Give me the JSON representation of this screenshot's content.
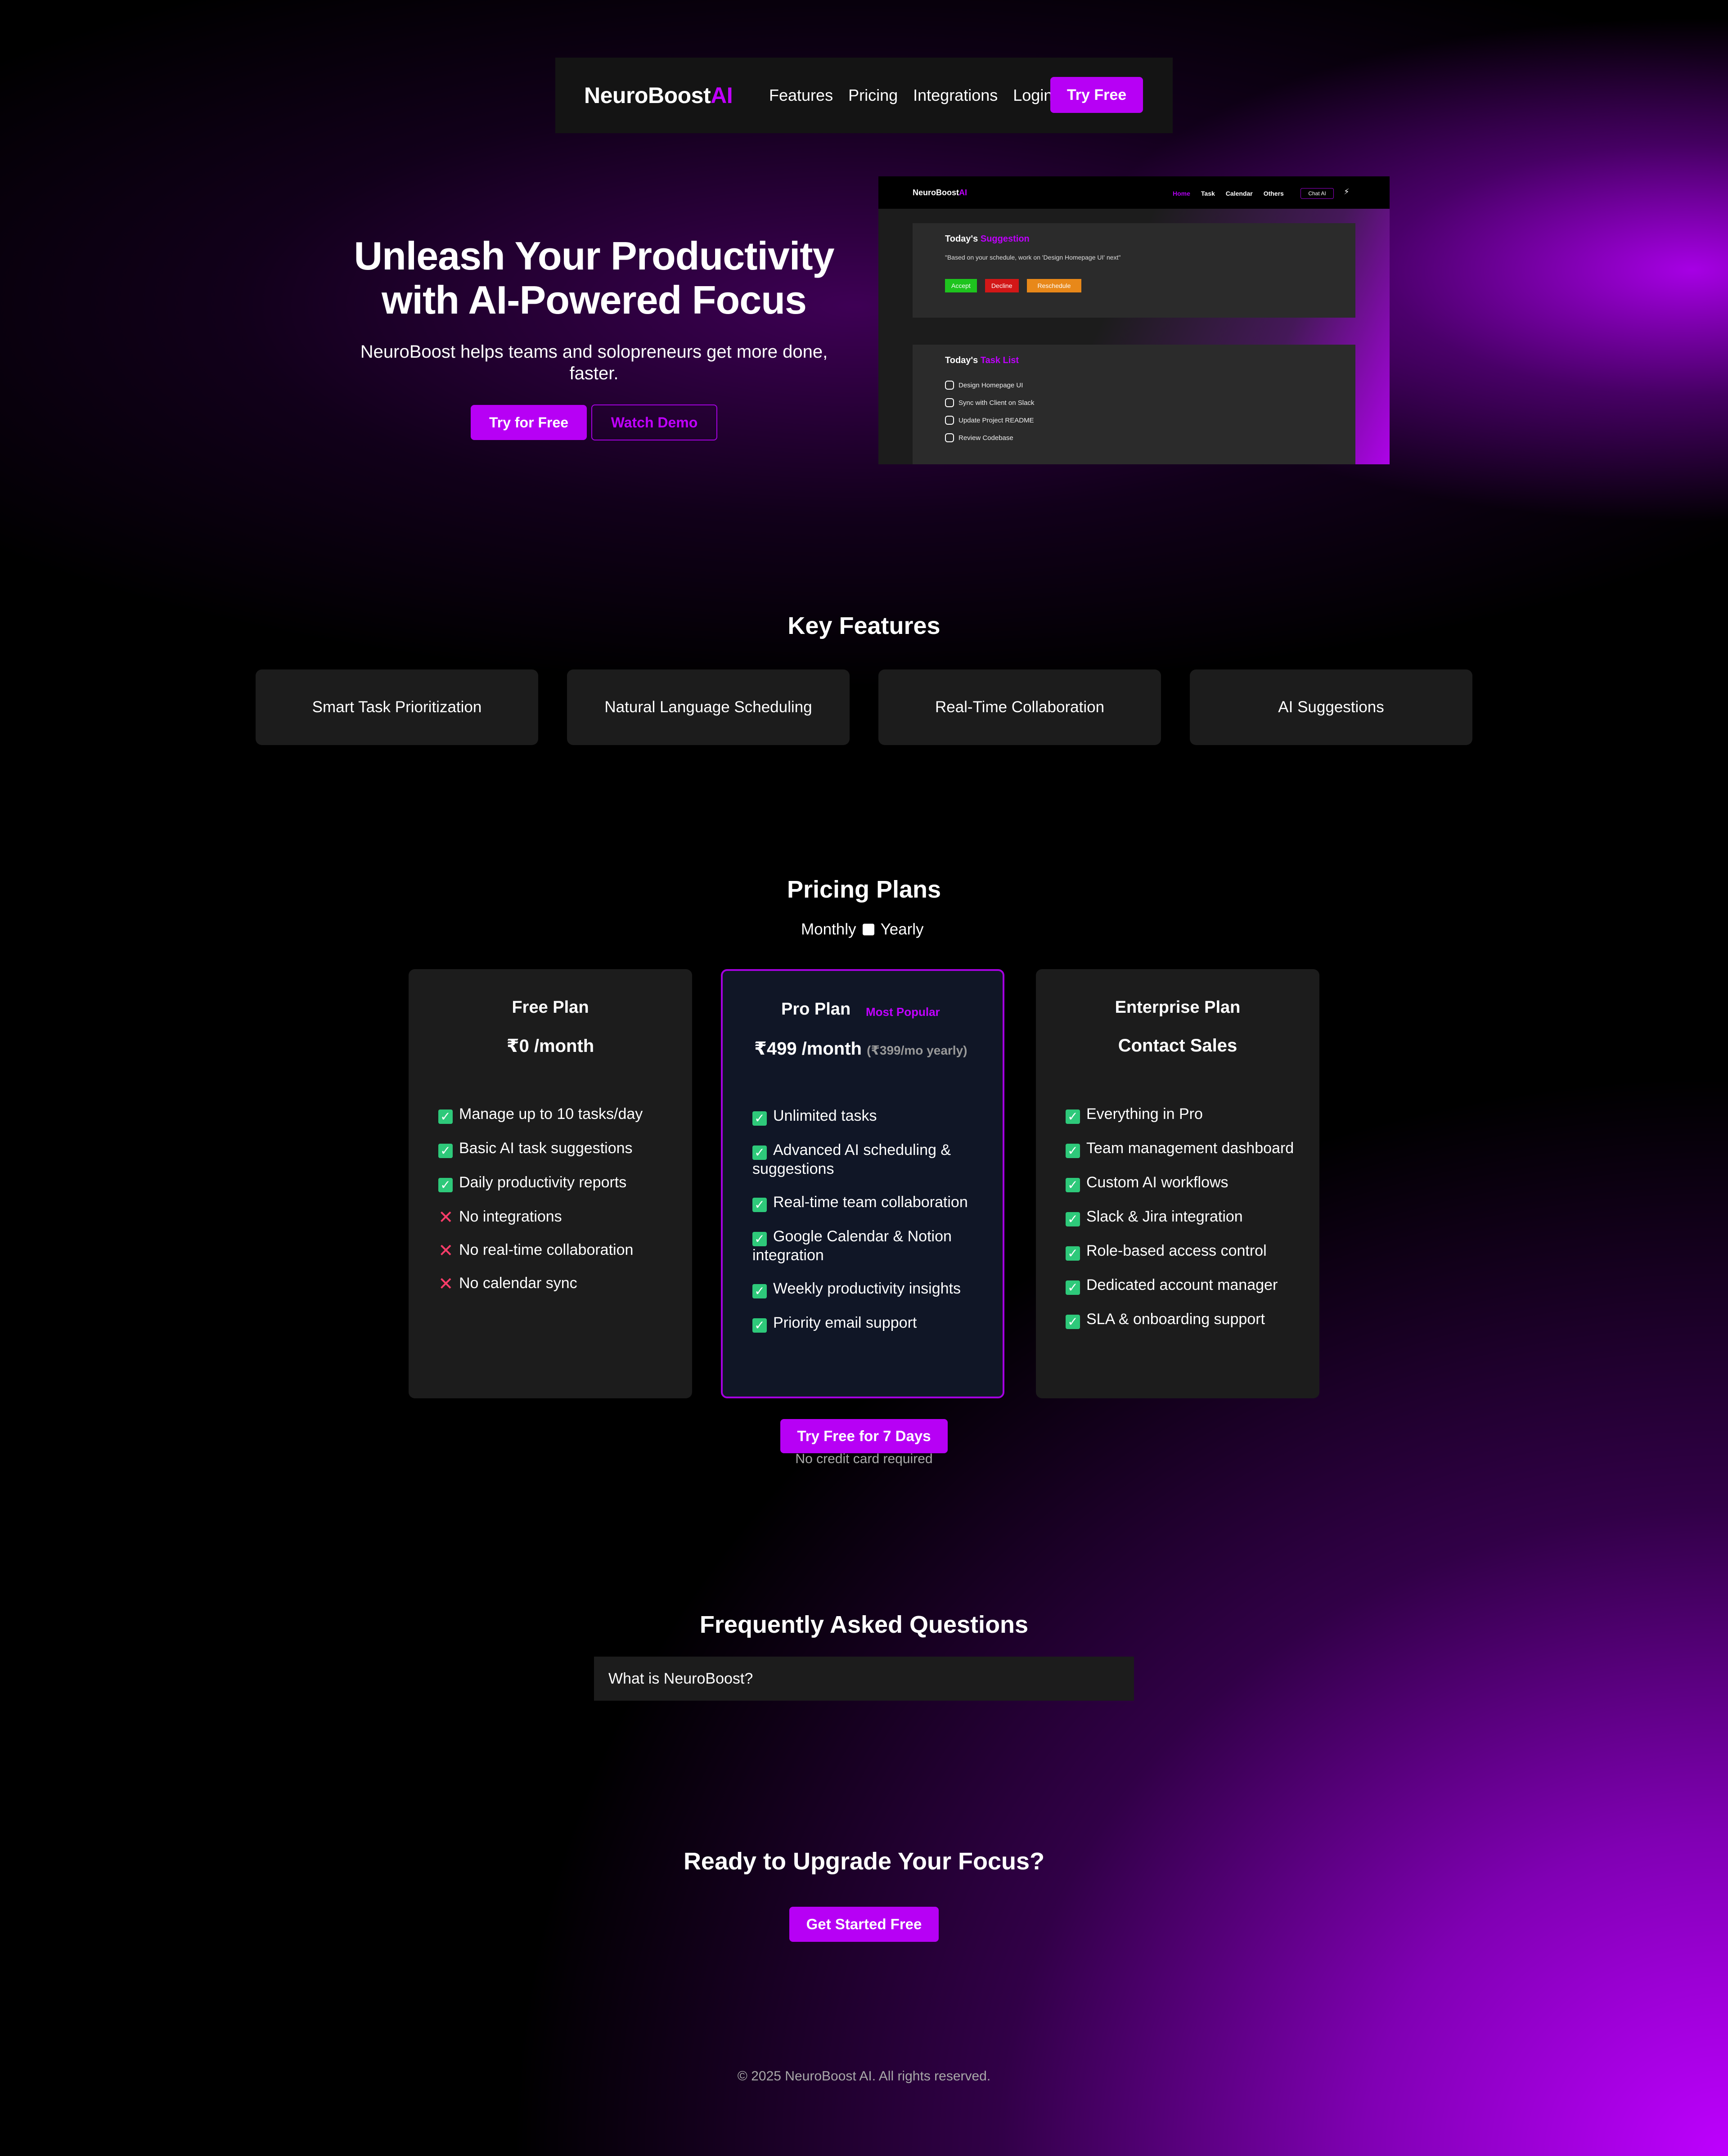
{
  "nav": {
    "brand_main": "NeuroBoost",
    "brand_accent": "AI",
    "links": [
      "Features",
      "Pricing",
      "Integrations",
      "Login"
    ],
    "cta": "Try Free"
  },
  "hero": {
    "title": "Unleash Your Productivity with AI-Powered Focus",
    "subtitle": "NeuroBoost helps teams and solopreneurs get more done, faster.",
    "primary_cta": "Try for Free",
    "secondary_cta": "Watch Demo"
  },
  "preview": {
    "brand_main": "NeuroBoost",
    "brand_accent": "AI",
    "links": [
      "Home",
      "Task",
      "Calendar",
      "Others"
    ],
    "chat_label": "Chat AI",
    "bolt": "⚡",
    "suggestion": {
      "title_prefix": "Today's",
      "title_accent": "Suggestion",
      "quote": "\"Based on your schedule, work on 'Design Homepage UI' next\"",
      "buttons": [
        "Accept",
        "Decline",
        "Reschedule"
      ]
    },
    "tasks": {
      "title_prefix": "Today's",
      "title_accent": "Task List",
      "items": [
        "Design Homepage UI",
        "Sync with Client on Slack",
        "Update Project README",
        "Review Codebase"
      ]
    }
  },
  "features": {
    "title": "Key Features",
    "items": [
      "Smart Task Prioritization",
      "Natural Language Scheduling",
      "Real-Time Collaboration",
      "AI Suggestions"
    ]
  },
  "pricing": {
    "title": "Pricing Plans",
    "billing_monthly": "Monthly",
    "billing_yearly": "Yearly",
    "plans": [
      {
        "name": "Free Plan",
        "price": "₹0 /month",
        "features": [
          {
            "text": "Manage up to 10 tasks/day",
            "included": true
          },
          {
            "text": "Basic AI task suggestions",
            "included": true
          },
          {
            "text": "Daily productivity reports",
            "included": true
          },
          {
            "text": "No integrations",
            "included": false
          },
          {
            "text": "No real-time collaboration",
            "included": false
          },
          {
            "text": "No calendar sync",
            "included": false
          }
        ]
      },
      {
        "name": "Pro Plan",
        "badge": "Most Popular",
        "price": "₹499 /month",
        "price_yearly": "(₹399/mo yearly)",
        "features": [
          {
            "text": "Unlimited tasks",
            "included": true
          },
          {
            "text": "Advanced AI scheduling & suggestions",
            "included": true
          },
          {
            "text": "Real-time team collaboration",
            "included": true
          },
          {
            "text": "Google Calendar & Notion integration",
            "included": true
          },
          {
            "text": "Weekly productivity insights",
            "included": true
          },
          {
            "text": "Priority email support",
            "included": true
          }
        ]
      },
      {
        "name": "Enterprise Plan",
        "price": "Contact Sales",
        "features": [
          {
            "text": "Everything in Pro",
            "included": true
          },
          {
            "text": "Team management dashboard",
            "included": true
          },
          {
            "text": "Custom AI workflows",
            "included": true
          },
          {
            "text": "Slack & Jira integration",
            "included": true
          },
          {
            "text": "Role-based access control",
            "included": true
          },
          {
            "text": "Dedicated account manager",
            "included": true
          },
          {
            "text": "SLA & onboarding support",
            "included": true
          }
        ]
      }
    ],
    "trial_cta": "Try Free for 7 Days",
    "trial_note": "No credit card required"
  },
  "faq": {
    "title": "Frequently Asked Questions",
    "items": [
      "What is NeuroBoost?"
    ]
  },
  "cta": {
    "title": "Ready to Upgrade Your Focus?",
    "button": "Get Started Free"
  },
  "footer": {
    "text": "© 2025 NeuroBoost AI. All rights reserved."
  },
  "colors": {
    "accent": "#b700f5",
    "card": "#1c1c1c",
    "pro_card": "#101626",
    "check": "#2ec97a",
    "cross": "#ff3d6a"
  }
}
